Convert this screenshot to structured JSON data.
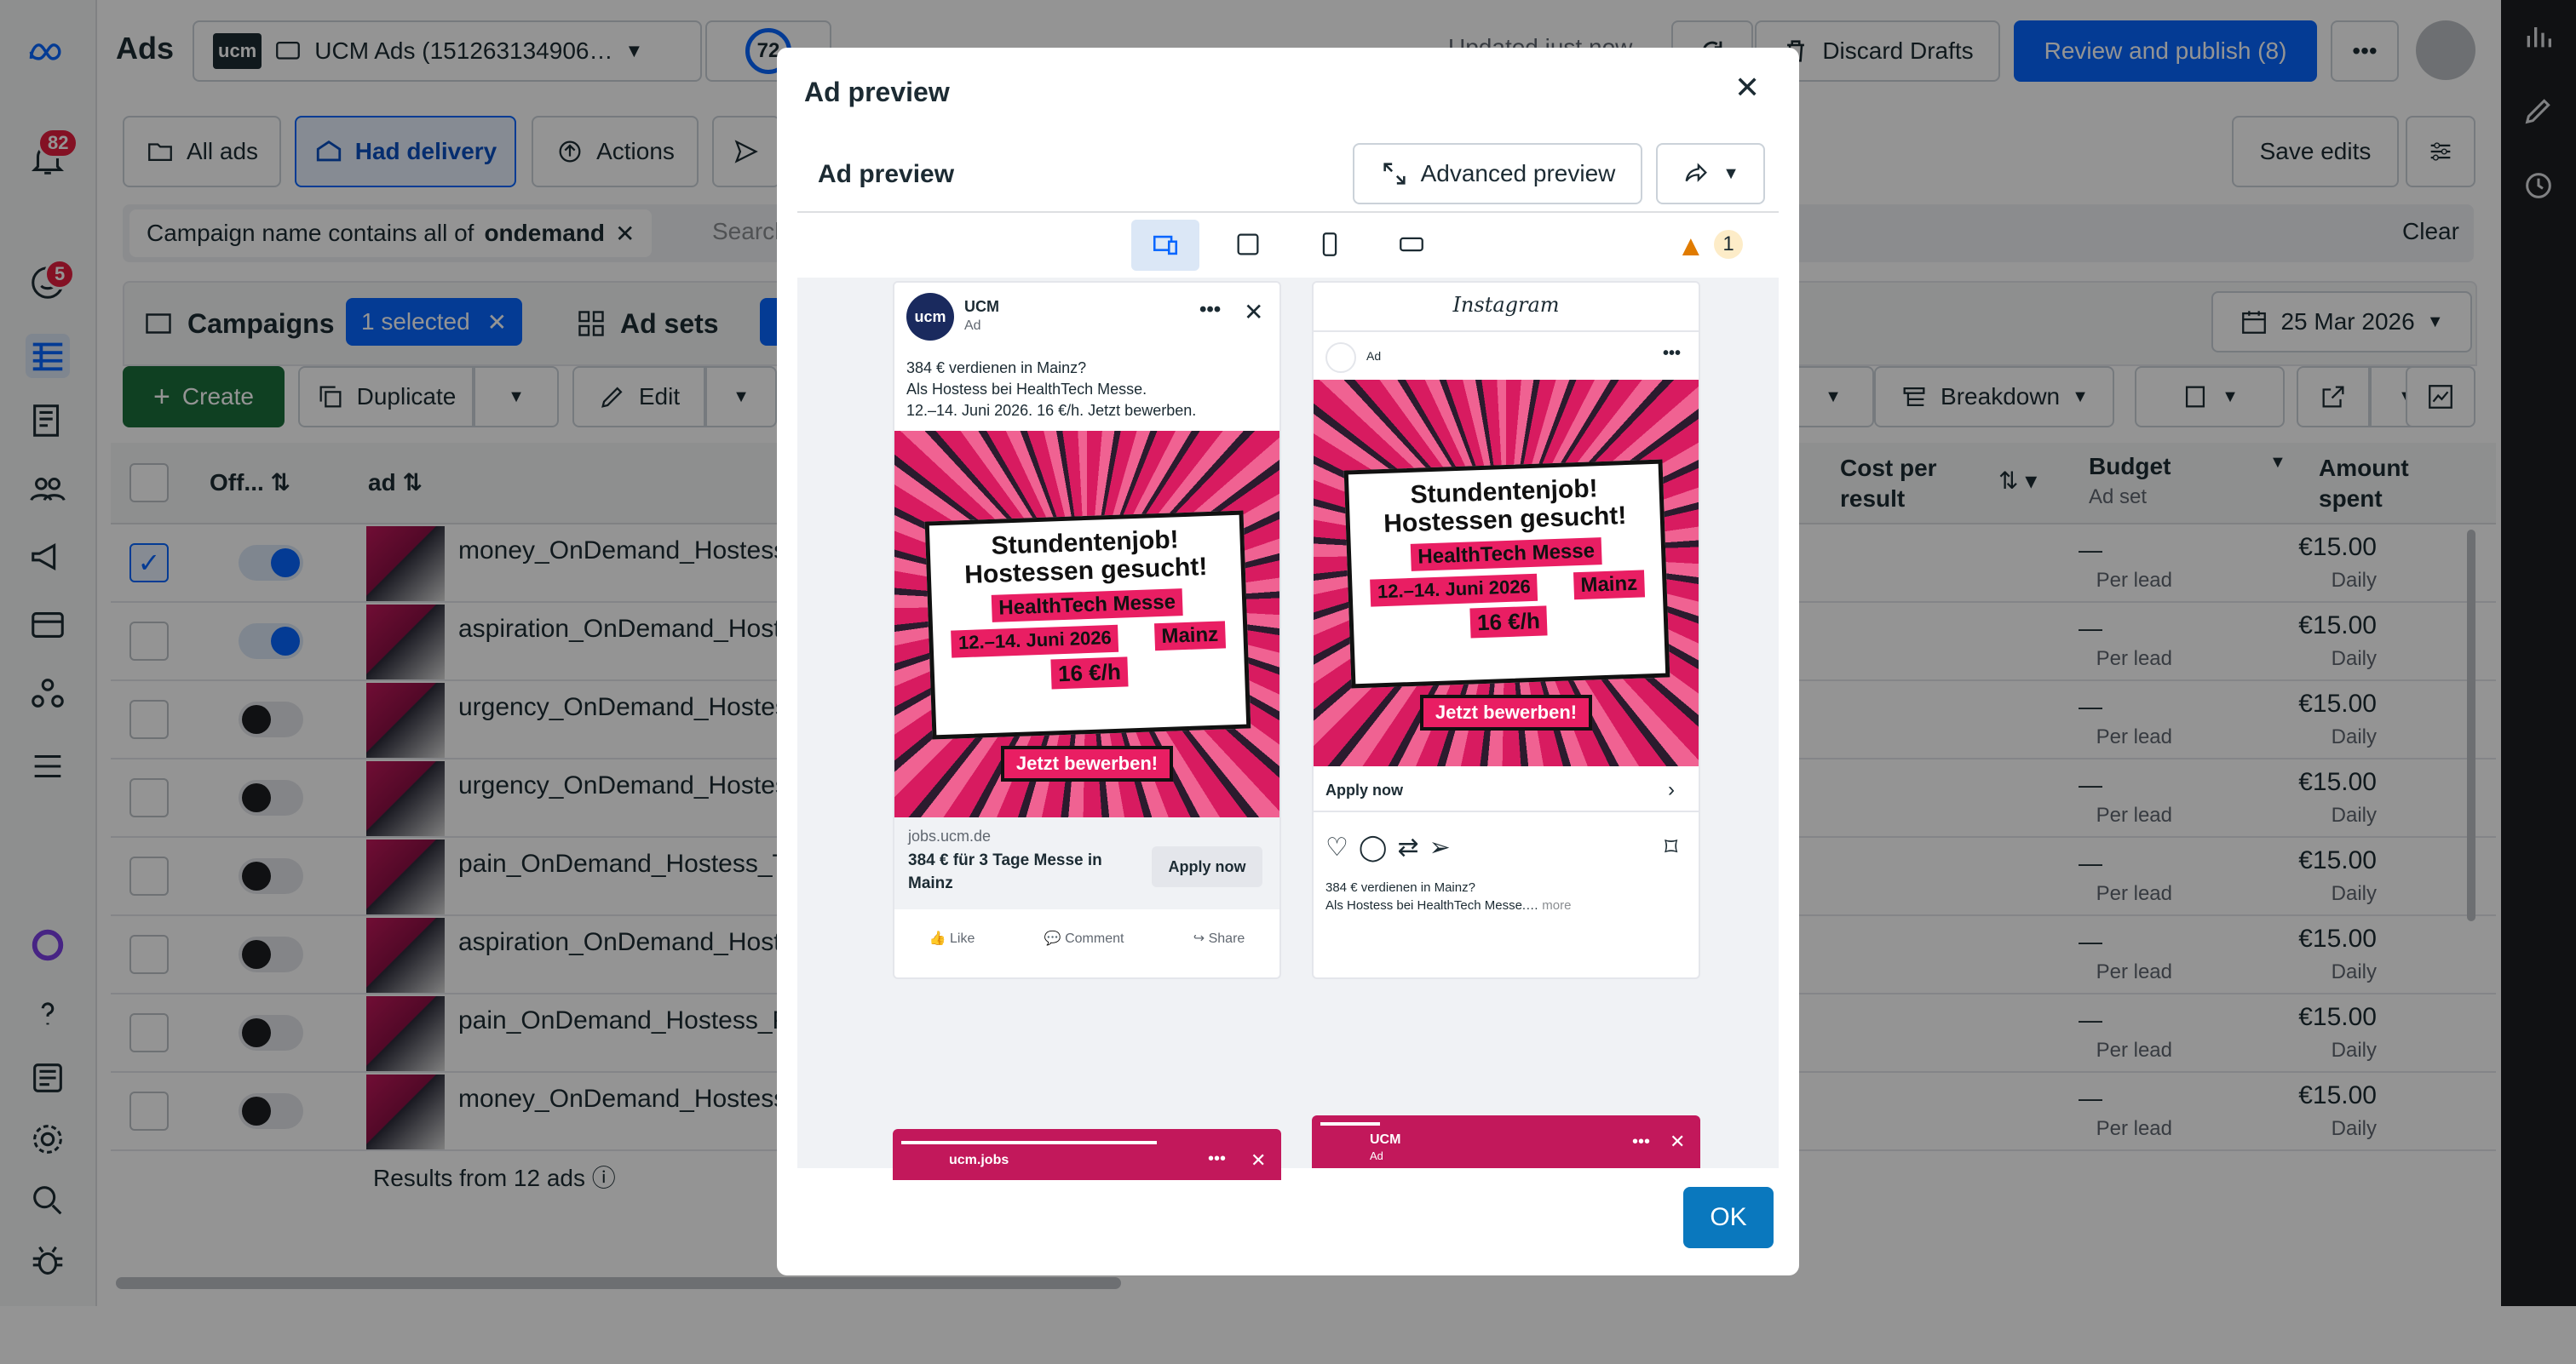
{
  "app": {
    "title": "Ads",
    "account": "UCM Ads (151263134906…",
    "account_logo": "ucm",
    "score": "72",
    "update_text": "Updated just now"
  },
  "header": {
    "discard": "Discard Drafts",
    "review": "Review and publish (8)",
    "save_edits": "Save edits"
  },
  "nav_badges": {
    "notifications": "82",
    "alerts": "5"
  },
  "filters": {
    "all_ads": "All ads",
    "had_delivery": "Had delivery",
    "actions": "Actions",
    "chip_label": "Campaign name contains all of",
    "chip_value": "ondemand",
    "search_placeholder": "Search",
    "clear": "Clear"
  },
  "levels": {
    "campaigns": "Campaigns",
    "selected": "1 selected",
    "ad_sets": "Ad sets",
    "date": "25 Mar 2026"
  },
  "toolbar": {
    "create": "Create",
    "duplicate": "Duplicate",
    "edit": "Edit",
    "breakdown": "Breakdown"
  },
  "table": {
    "columns": {
      "off": "Off...",
      "ad": "ad",
      "cost_per_result": "Cost per result",
      "budget": "Budget",
      "budget_sub": "Ad set",
      "amount_spent": "Amount spent"
    },
    "rows": [
      {
        "name": "money_OnDemand_Hostess_",
        "on": true,
        "checked": true,
        "cost": "—",
        "cost_sub": "Per lead",
        "budget": "€15.00",
        "budget_sub": "Daily"
      },
      {
        "name": "aspiration_OnDemand_Hoste",
        "on": true,
        "checked": false,
        "cost": "—",
        "cost_sub": "Per lead",
        "budget": "€15.00",
        "budget_sub": "Daily"
      },
      {
        "name": "urgency_OnDemand_Hostess",
        "on": false,
        "checked": false,
        "cost": "—",
        "cost_sub": "Per lead",
        "budget": "€15.00",
        "budget_sub": "Daily"
      },
      {
        "name": "urgency_OnDemand_Hostess",
        "on": false,
        "checked": false,
        "cost": "—",
        "cost_sub": "Per lead",
        "budget": "€15.00",
        "budget_sub": "Daily"
      },
      {
        "name": "pain_OnDemand_Hostess_Te",
        "on": false,
        "checked": false,
        "cost": "—",
        "cost_sub": "Per lead",
        "budget": "€15.00",
        "budget_sub": "Daily"
      },
      {
        "name": "aspiration_OnDemand_Hoste",
        "on": false,
        "checked": false,
        "cost": "—",
        "cost_sub": "Per lead",
        "budget": "€15.00",
        "budget_sub": "Daily"
      },
      {
        "name": "pain_OnDemand_Hostess_Pe",
        "on": false,
        "checked": false,
        "cost": "—",
        "cost_sub": "Per lead",
        "budget": "€15.00",
        "budget_sub": "Daily"
      },
      {
        "name": "money_OnDemand_Hostess_",
        "on": false,
        "checked": false,
        "cost": "—",
        "cost_sub": "Per lead",
        "budget": "€15.00",
        "budget_sub": "Daily"
      }
    ],
    "results": "Results from 12 ads"
  },
  "modal": {
    "title": "Ad preview",
    "subtitle": "Ad preview",
    "advanced": "Advanced preview",
    "warning_count": "1",
    "ok": "OK",
    "fb": {
      "page": "UCM",
      "sponsored": "Ad",
      "text1": "384 € verdienen in Mainz?",
      "text2": "Als Hostess bei HealthTech Messe.",
      "text3": "12.–14. Juni 2026. 16 €/h. Jetzt bewerben.",
      "domain": "jobs.ucm.de",
      "headline": "384 € für 3 Tage Messe in Mainz",
      "cta": "Apply now",
      "like": "Like",
      "comment": "Comment",
      "share": "Share"
    },
    "creative": {
      "h1": "Stundentenjob!",
      "h2": "Hostessen gesucht!",
      "event": "HealthTech Messe",
      "dates": "12.–14. Juni 2026",
      "city": "Mainz",
      "rate": "16 €/h",
      "cta": "Jetzt bewerben!"
    },
    "ig": {
      "brand": "Instagram",
      "sponsored": "Ad",
      "cta": "Apply now",
      "caption1": "384 € verdienen in Mainz?",
      "caption2": "Als Hostess bei HealthTech Messe.…",
      "more": "more"
    },
    "story1": {
      "name": "ucm.jobs"
    },
    "story2": {
      "name": "UCM",
      "sponsored": "Ad"
    }
  },
  "colors": {
    "primary": "#1877f2",
    "dark_green": "#1b6e3c",
    "pink": "#e91e63",
    "warning": "#e07b00"
  }
}
